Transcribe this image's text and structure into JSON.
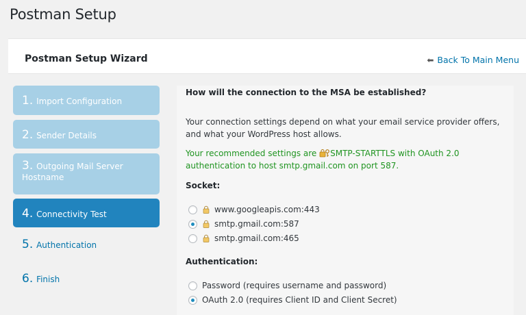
{
  "page_title": "Postman Setup",
  "header": {
    "wizard_title": "Postman Setup Wizard",
    "back_link": "Back To Main Menu"
  },
  "steps": [
    {
      "num": "1.",
      "label": "Import Configuration",
      "state": "done"
    },
    {
      "num": "2.",
      "label": "Sender Details",
      "state": "done"
    },
    {
      "num": "3.",
      "label": "Outgoing Mail Server Hostname",
      "state": "done"
    },
    {
      "num": "4.",
      "label": "Connectivity Test",
      "state": "current"
    },
    {
      "num": "5.",
      "label": "Authentication",
      "state": "todo"
    },
    {
      "num": "6.",
      "label": "Finish",
      "state": "todo"
    }
  ],
  "main": {
    "question": "How will the connection to the MSA be established?",
    "description": "Your connection settings depend on what your email service provider offers, and what your WordPress host allows.",
    "recommend_prefix": "Your recommended settings are ",
    "recommend_body": "SMTP-STARTTLS with OAuth 2.0 authentication to host smtp.gmail.com on port 587.",
    "socket_label": "Socket:",
    "sockets": [
      {
        "label": "www.googleapis.com:443",
        "checked": false
      },
      {
        "label": "smtp.gmail.com:587",
        "checked": true
      },
      {
        "label": "smtp.gmail.com:465",
        "checked": false
      }
    ],
    "auth_label": "Authentication:",
    "auth_options": [
      {
        "label": "Password (requires username and password)",
        "checked": false
      },
      {
        "label": "OAuth 2.0 (requires Client ID and Client Secret)",
        "checked": true
      }
    ]
  },
  "colors": {
    "accent": "#2184be",
    "done_step": "#a7d0e6",
    "link": "#0073aa",
    "recommend": "#1f9420"
  }
}
